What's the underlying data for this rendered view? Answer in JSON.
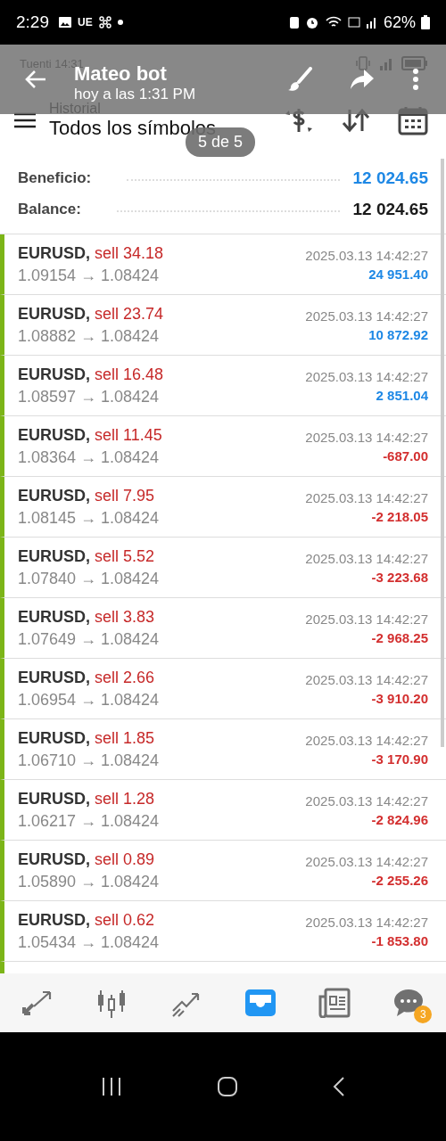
{
  "status_bar": {
    "time": "2:29",
    "carrier": "UE",
    "battery": "62%"
  },
  "viewer": {
    "title": "Mateo bot",
    "subtitle": "hoy a las 1:31 PM",
    "counter": "5 de 5"
  },
  "screenshot": {
    "status_bar": {
      "carrier_time": "Tuenti 14:31"
    },
    "toolbar": {
      "title": "Historial",
      "subtitle": "Todos los símbolos"
    },
    "summary": [
      {
        "label": "Beneficio:",
        "value": "12 024.65",
        "color": "#1e88e5"
      },
      {
        "label": "Balance:",
        "value": "12 024.65",
        "color": "#1a1a1a"
      }
    ],
    "trades": [
      {
        "symbol": "EURUSD,",
        "side": "sell 34.18",
        "prices": "1.09154 → 1.08424",
        "time": "2025.03.13 14:42:27",
        "profit": "24 951.40",
        "color": "#1e88e5"
      },
      {
        "symbol": "EURUSD,",
        "side": "sell 23.74",
        "prices": "1.08882 → 1.08424",
        "time": "2025.03.13 14:42:27",
        "profit": "10 872.92",
        "color": "#1e88e5"
      },
      {
        "symbol": "EURUSD,",
        "side": "sell 16.48",
        "prices": "1.08597 → 1.08424",
        "time": "2025.03.13 14:42:27",
        "profit": "2 851.04",
        "color": "#1e88e5"
      },
      {
        "symbol": "EURUSD,",
        "side": "sell 11.45",
        "prices": "1.08364 → 1.08424",
        "time": "2025.03.13 14:42:27",
        "profit": "-687.00",
        "color": "#d32f2f"
      },
      {
        "symbol": "EURUSD,",
        "side": "sell 7.95",
        "prices": "1.08145 → 1.08424",
        "time": "2025.03.13 14:42:27",
        "profit": "-2 218.05",
        "color": "#d32f2f"
      },
      {
        "symbol": "EURUSD,",
        "side": "sell 5.52",
        "prices": "1.07840 → 1.08424",
        "time": "2025.03.13 14:42:27",
        "profit": "-3 223.68",
        "color": "#d32f2f"
      },
      {
        "symbol": "EURUSD,",
        "side": "sell 3.83",
        "prices": "1.07649 → 1.08424",
        "time": "2025.03.13 14:42:27",
        "profit": "-2 968.25",
        "color": "#d32f2f"
      },
      {
        "symbol": "EURUSD,",
        "side": "sell 2.66",
        "prices": "1.06954 → 1.08424",
        "time": "2025.03.13 14:42:27",
        "profit": "-3 910.20",
        "color": "#d32f2f"
      },
      {
        "symbol": "EURUSD,",
        "side": "sell 1.85",
        "prices": "1.06710 → 1.08424",
        "time": "2025.03.13 14:42:27",
        "profit": "-3 170.90",
        "color": "#d32f2f"
      },
      {
        "symbol": "EURUSD,",
        "side": "sell 1.28",
        "prices": "1.06217 → 1.08424",
        "time": "2025.03.13 14:42:27",
        "profit": "-2 824.96",
        "color": "#d32f2f"
      },
      {
        "symbol": "EURUSD,",
        "side": "sell 0.89",
        "prices": "1.05890 → 1.08424",
        "time": "2025.03.13 14:42:27",
        "profit": "-2 255.26",
        "color": "#d32f2f"
      },
      {
        "symbol": "EURUSD,",
        "side": "sell 0.62",
        "prices": "1.05434 → 1.08424",
        "time": "2025.03.13 14:42:27",
        "profit": "-1 853.80",
        "color": "#d32f2f"
      }
    ],
    "nav": [
      {
        "kind": "trade",
        "selected": false
      },
      {
        "kind": "candles",
        "selected": false
      },
      {
        "kind": "trend",
        "selected": false
      },
      {
        "kind": "inbox",
        "selected": true
      },
      {
        "kind": "news",
        "selected": false
      },
      {
        "kind": "chat",
        "selected": false,
        "badge": "3"
      }
    ]
  }
}
